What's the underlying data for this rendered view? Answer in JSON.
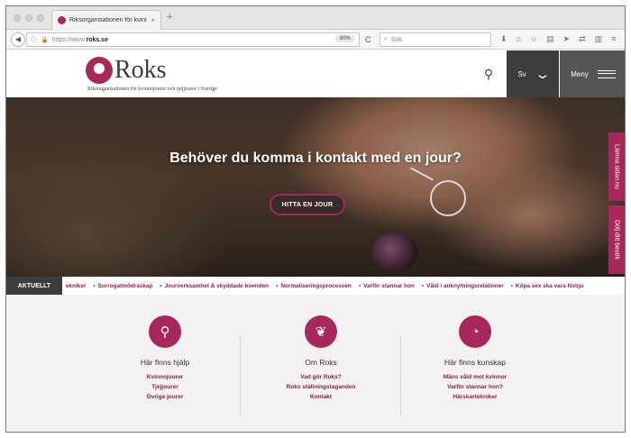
{
  "browser": {
    "tab_title": "Riksorganisationen för kvinno",
    "tab_close": "×",
    "new_tab": "+",
    "url_prefix": "https://www.",
    "url_domain": "roks.se",
    "zoom": "80%",
    "search_placeholder": "Sök"
  },
  "header": {
    "logo_word": "Roks",
    "logo_sub": "Riksorganisationen för kvinnojourer och tjejjourer i Sverige",
    "lang_label": "Sv",
    "menu_label": "Meny"
  },
  "hero": {
    "title": "Behöver du komma i kontakt med en jour?",
    "button": "HITTA EN JOUR"
  },
  "side_tabs": {
    "leave": "Lämna sidan nu",
    "hide": "Dölj ditt besök"
  },
  "ticker": {
    "label": "AKTUELLT",
    "items": [
      "ekniker",
      "Surrogatmödraskap",
      "Jourverksamhet & skyddade boenden",
      "Normaliseringsprocessen",
      "Varför stannar hon",
      "Våld i anknytningsrelationer",
      "Köpa sex ska vara förbju"
    ]
  },
  "info": {
    "columns": [
      {
        "icon": "location-pin-icon",
        "title": "Här finns hjälp",
        "links": [
          "Kvinnojourer",
          "Tjejjourer",
          "Övriga jourer"
        ]
      },
      {
        "icon": "heart-hands-icon",
        "title": "Om Roks",
        "links": [
          "Vad gör Roks?",
          "Roks ställningstaganden",
          "Kontakt"
        ]
      },
      {
        "icon": "chart-pie-icon",
        "title": "Här finns kunskap",
        "links": [
          "Mäns våld mot kvinnor",
          "Varför stannar hon?",
          "Härskartekniker"
        ]
      }
    ]
  },
  "colors": {
    "accent": "#a8285e",
    "dark": "#3d3d3d"
  }
}
